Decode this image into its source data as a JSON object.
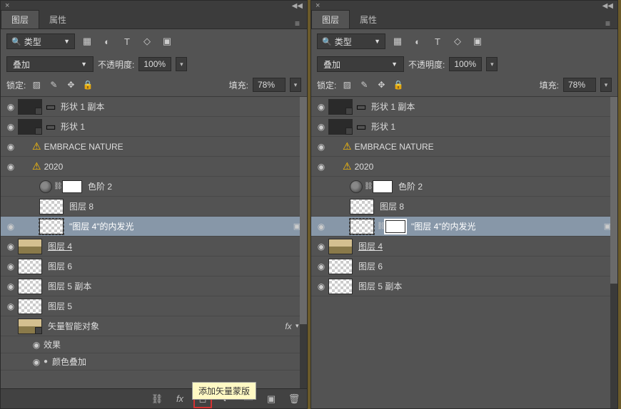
{
  "panelLeft": {
    "tabs": {
      "layers": "图层",
      "properties": "属性"
    },
    "filter": {
      "label": "类型"
    },
    "blend": {
      "mode": "叠加",
      "opacityLabel": "不透明度:",
      "opacityValue": "100%"
    },
    "lock": {
      "label": "锁定:",
      "fillLabel": "填充:",
      "fillValue": "78%"
    },
    "layers": [
      {
        "name": "形状 1 副本"
      },
      {
        "name": "形状 1"
      },
      {
        "name": "EMBRACE NATURE"
      },
      {
        "name": "2020"
      },
      {
        "name": "色阶 2"
      },
      {
        "name": "图层 8"
      },
      {
        "name": "\"图层 4\"的内发光"
      },
      {
        "name": "图层 4"
      },
      {
        "name": "图层 6"
      },
      {
        "name": "图层 5 副本"
      },
      {
        "name": "图层 5"
      },
      {
        "name": "矢量智能对象"
      }
    ],
    "fx": {
      "effects": "效果",
      "colorOverlay": "颜色叠加"
    },
    "tooltip": "添加矢量蒙版"
  },
  "panelRight": {
    "tabs": {
      "layers": "图层",
      "properties": "属性"
    },
    "filter": {
      "label": "类型"
    },
    "blend": {
      "mode": "叠加",
      "opacityLabel": "不透明度:",
      "opacityValue": "100%"
    },
    "lock": {
      "label": "锁定:",
      "fillLabel": "填充:",
      "fillValue": "78%"
    },
    "layers": [
      {
        "name": "形状 1 副本"
      },
      {
        "name": "形状 1"
      },
      {
        "name": "EMBRACE NATURE"
      },
      {
        "name": "2020"
      },
      {
        "name": "色阶 2"
      },
      {
        "name": "图层 8"
      },
      {
        "name": "\"图层 4\"的内发光"
      },
      {
        "name": "图层 4"
      },
      {
        "name": "图层 6"
      },
      {
        "name": "图层 5 副本"
      }
    ]
  }
}
